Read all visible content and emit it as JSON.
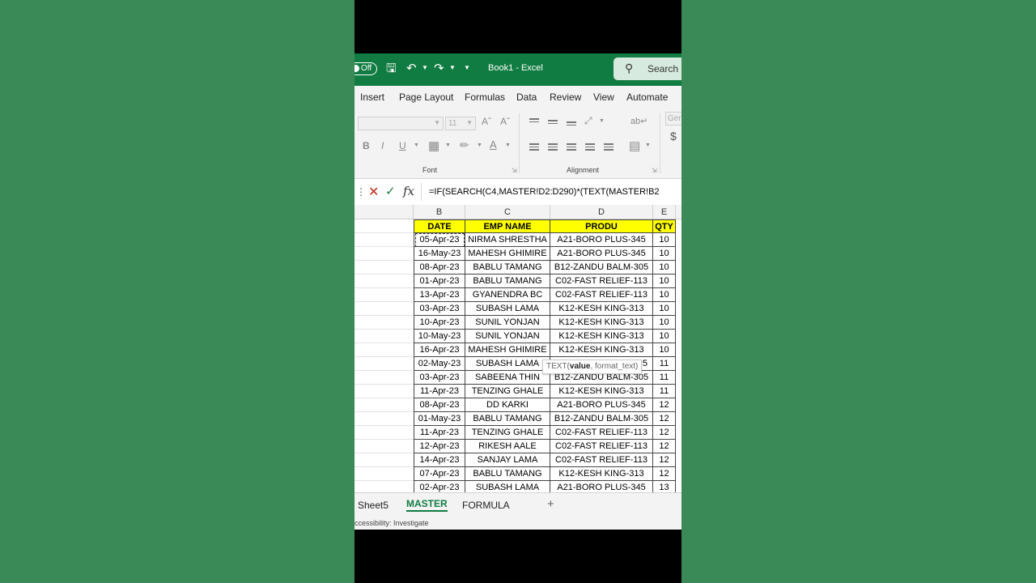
{
  "titlebar": {
    "autosave": "Off",
    "doc_title": "Book1  -  Excel",
    "search_label": "Search"
  },
  "ribbon_tabs": [
    "Insert",
    "Page Layout",
    "Formulas",
    "Data",
    "Review",
    "View",
    "Automate"
  ],
  "ribbon": {
    "font_size": "11",
    "font_group_label": "Font",
    "alignment_group_label": "Alignment",
    "number_format_partial": "Ger",
    "currency_symbol": "$"
  },
  "formula_bar": {
    "formula": "=IF(SEARCH(C4,MASTER!D2:D290)*(TEXT(MASTER!B2"
  },
  "columns": [
    "B",
    "C",
    "D",
    "E"
  ],
  "headers": [
    "DATE",
    "EMP NAME",
    "PRODU",
    "QTY"
  ],
  "rows": [
    {
      "date": "05-Apr-23",
      "emp": "NIRMA SHRESTHA",
      "prod": "A21-BORO PLUS-345",
      "qty": "10"
    },
    {
      "date": "16-May-23",
      "emp": "MAHESH GHIMIRE",
      "prod": "A21-BORO PLUS-345",
      "qty": "10"
    },
    {
      "date": "08-Apr-23",
      "emp": "BABLU TAMANG",
      "prod": "B12-ZANDU BALM-305",
      "qty": "10"
    },
    {
      "date": "01-Apr-23",
      "emp": "BABLU TAMANG",
      "prod": "C02-FAST RELIEF-113",
      "qty": "10"
    },
    {
      "date": "13-Apr-23",
      "emp": "GYANENDRA BC",
      "prod": "C02-FAST RELIEF-113",
      "qty": "10"
    },
    {
      "date": "03-Apr-23",
      "emp": "SUBASH LAMA",
      "prod": "K12-KESH KING-313",
      "qty": "10"
    },
    {
      "date": "10-Apr-23",
      "emp": "SUNIL YONJAN",
      "prod": "K12-KESH KING-313",
      "qty": "10"
    },
    {
      "date": "10-May-23",
      "emp": "SUNIL YONJAN",
      "prod": "K12-KESH KING-313",
      "qty": "10"
    },
    {
      "date": "16-Apr-23",
      "emp": "MAHESH GHIMIRE",
      "prod": "K12-KESH KING-313",
      "qty": "10"
    },
    {
      "date": "02-May-23",
      "emp": "SUBASH LAMA",
      "prod": "5",
      "qty": "11"
    },
    {
      "date": "03-Apr-23",
      "emp": "SABEENA THIN",
      "prod": "B12-ZANDU BALM-305",
      "qty": "11"
    },
    {
      "date": "11-Apr-23",
      "emp": "TENZING GHALE",
      "prod": "K12-KESH KING-313",
      "qty": "11"
    },
    {
      "date": "08-Apr-23",
      "emp": "DD KARKI",
      "prod": "A21-BORO PLUS-345",
      "qty": "12"
    },
    {
      "date": "01-May-23",
      "emp": "BABLU TAMANG",
      "prod": "B12-ZANDU BALM-305",
      "qty": "12"
    },
    {
      "date": "11-Apr-23",
      "emp": "TENZING GHALE",
      "prod": "C02-FAST RELIEF-113",
      "qty": "12"
    },
    {
      "date": "12-Apr-23",
      "emp": "RIKESH AALE",
      "prod": "C02-FAST RELIEF-113",
      "qty": "12"
    },
    {
      "date": "14-Apr-23",
      "emp": "SANJAY LAMA",
      "prod": "C02-FAST RELIEF-113",
      "qty": "12"
    },
    {
      "date": "07-Apr-23",
      "emp": "BABLU TAMANG",
      "prod": "K12-KESH KING-313",
      "qty": "12"
    },
    {
      "date": "02-Apr-23",
      "emp": "SUBASH LAMA",
      "prod": "A21-BORO PLUS-345",
      "qty": "13"
    }
  ],
  "tooltip": {
    "fn": "TEXT(",
    "arg_bold": "value",
    "rest": ", format_text)"
  },
  "sheet_tabs": [
    "Sheet5",
    "MASTER",
    "FORMULA"
  ],
  "active_sheet": "MASTER",
  "status": "ccessibility: Investigate"
}
